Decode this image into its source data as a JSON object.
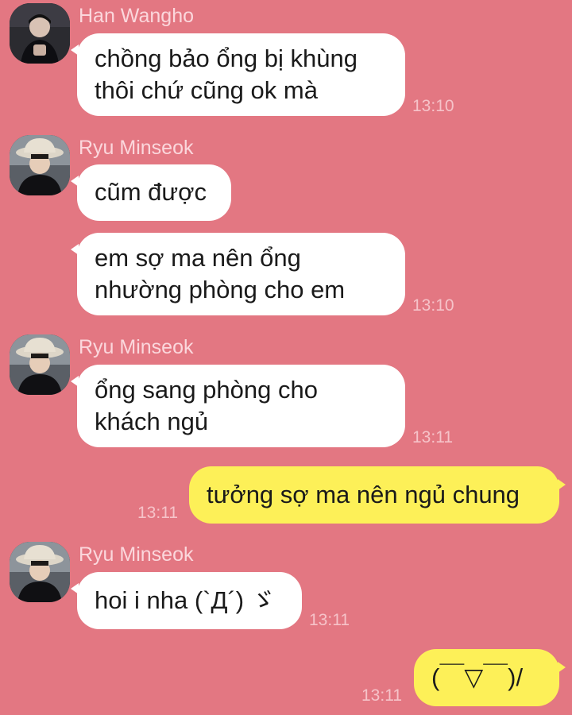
{
  "colors": {
    "background": "#e37782",
    "incoming_bubble": "#ffffff",
    "outgoing_bubble": "#fdf058",
    "sender_name": "#fbd7dc",
    "timestamp": "#f6c3c9"
  },
  "messages": [
    {
      "sender": "Han Wangho",
      "avatar": "avatar-photo-icon",
      "lines": [
        "chồng bảo ổng bị khùng",
        "thôi chứ cũng ok mà"
      ],
      "time": "13:10"
    },
    {
      "sender": "Ryu Minseok",
      "avatar": "avatar-photo-icon",
      "lines": [
        "cũm được"
      ]
    },
    {
      "lines": [
        "em sợ ma nên ổng",
        "nhường phòng cho em"
      ],
      "time": "13:10"
    },
    {
      "sender": "Ryu Minseok",
      "avatar": "avatar-photo-icon",
      "lines": [
        "ổng sang phòng cho",
        "khách ngủ"
      ],
      "time": "13:11"
    },
    {
      "direction": "outgoing",
      "lines": [
        "tưởng sợ ma nên ngủ chung"
      ],
      "time": "13:11"
    },
    {
      "sender": "Ryu Minseok",
      "avatar": "avatar-photo-icon",
      "lines": [
        "hoi i nha (`Д´) ゞ"
      ],
      "time": "13:11"
    },
    {
      "direction": "outgoing",
      "lines": [
        "(￣▽￣)/"
      ],
      "time": "13:11"
    }
  ]
}
